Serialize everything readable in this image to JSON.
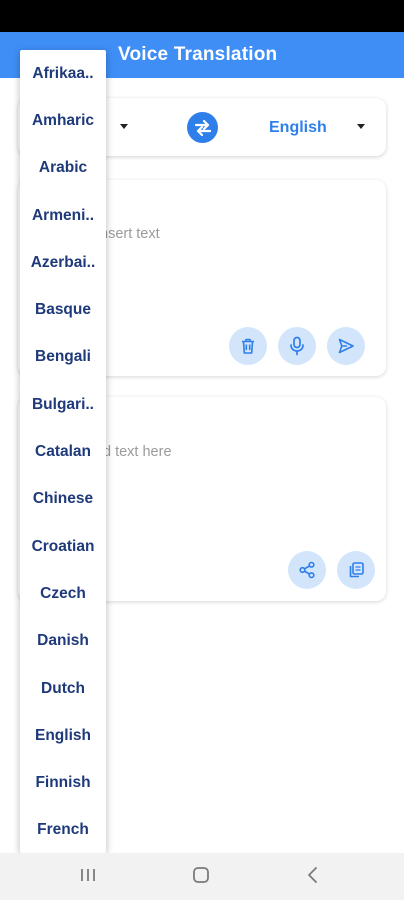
{
  "app": {
    "title": "Voice Translation"
  },
  "languages": {
    "target": "English"
  },
  "input": {
    "placeholder": "nsert text"
  },
  "output": {
    "placeholder": "d text here"
  },
  "dropdown": {
    "options": [
      "Afrikaa..",
      "Amharic",
      "Arabic",
      "Armeni..",
      "Azerbai..",
      "Basque",
      "Bengali",
      "Bulgari..",
      "Catalan",
      "Chinese",
      "Croatian",
      "Czech",
      "Danish",
      "Dutch",
      "English",
      "Finnish",
      "French"
    ]
  },
  "icons": {
    "swap": "swap-arrows-icon",
    "delete": "trash-icon",
    "mic": "microphone-icon",
    "send": "send-icon",
    "share": "share-icon",
    "copy": "copy-icon"
  },
  "colors": {
    "app_bar": "#3f8ef6",
    "accent": "#2f7fea",
    "action_bg": "#d2e5fb",
    "menu_text": "#1f3a7a"
  }
}
